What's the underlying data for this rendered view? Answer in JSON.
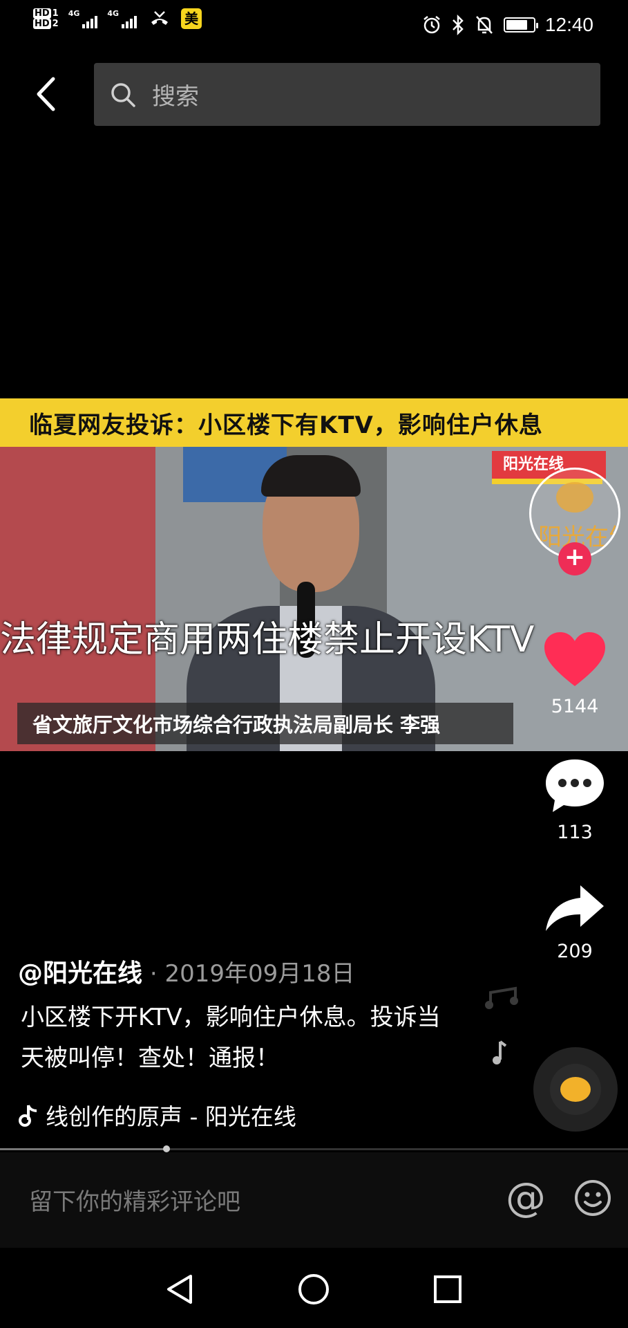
{
  "status_bar": {
    "time": "12:40",
    "hd1": "HD",
    "hd2": "HD",
    "net1": "4G",
    "net2": "4G",
    "app_badge": "美",
    "battery_level": 0.8
  },
  "search": {
    "placeholder": "搜索"
  },
  "video": {
    "banner_title": "临夏网友投诉：小区楼下有KTV，影响住户休息",
    "logo_tag": "阳光在线",
    "caption_main": "法律规定商用两住楼禁止开设KTV",
    "caption_sub": "省文旅厅文化市场综合行政执法局副局长 李强",
    "avatar_text": "阳光在线"
  },
  "actions": {
    "likes": "5144",
    "comments": "113",
    "shares": "209",
    "follow_symbol": "+"
  },
  "post": {
    "author": "@阳光在线",
    "date": " · 2019年09月18日",
    "description": "小区楼下开KTV，影响住户休息。投诉当天被叫停！查处！通报！",
    "music": "线创作的原声 - 阳光在线",
    "progress": 0.265
  },
  "comment_input": {
    "placeholder": "留下你的精彩评论吧",
    "at_symbol": "@"
  },
  "colors": {
    "like": "#ff2d55",
    "banner": "#f3cf2d",
    "follow": "#ee2d56"
  }
}
